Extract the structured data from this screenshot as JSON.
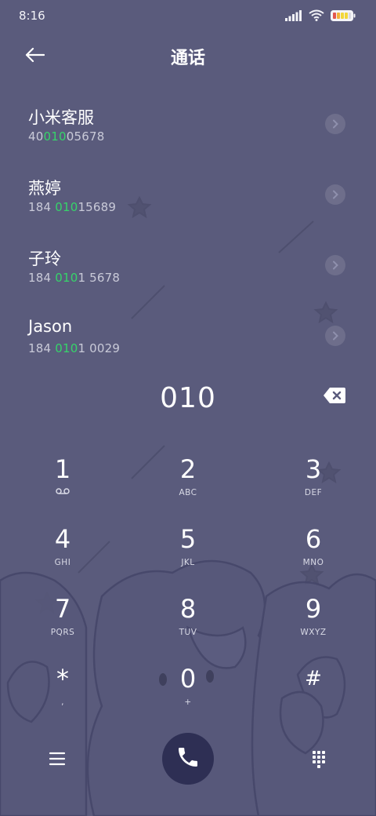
{
  "status_bar": {
    "time": "8:16",
    "icons": [
      "signal-icon",
      "wifi-icon",
      "battery-icon"
    ]
  },
  "header": {
    "title": "通话",
    "back_icon": "arrow-left-icon"
  },
  "contacts": [
    {
      "name": "小米客服",
      "number_pre": "40",
      "number_match": "010",
      "number_post": "05678"
    },
    {
      "name": "燕婷",
      "number_pre": "184 ",
      "number_match": "010",
      "number_post": "15689"
    },
    {
      "name": "子玲",
      "number_pre": "184 ",
      "number_match": "010",
      "number_post": "1 5678"
    },
    {
      "name": "Jason",
      "number_pre": "184 ",
      "number_match": "010",
      "number_post": "1 0029"
    }
  ],
  "dial": {
    "entered": "010",
    "backspace_icon": "backspace-icon"
  },
  "keypad": [
    {
      "digit": "1",
      "letters": "",
      "sub_icon": "voicemail-icon"
    },
    {
      "digit": "2",
      "letters": "ABC"
    },
    {
      "digit": "3",
      "letters": "DEF"
    },
    {
      "digit": "4",
      "letters": "GHI"
    },
    {
      "digit": "5",
      "letters": "JKL"
    },
    {
      "digit": "6",
      "letters": "MNO"
    },
    {
      "digit": "7",
      "letters": "PQRS"
    },
    {
      "digit": "8",
      "letters": "TUV"
    },
    {
      "digit": "9",
      "letters": "WXYZ"
    },
    {
      "digit": "*",
      "letters": ","
    },
    {
      "digit": "0",
      "letters": "+"
    },
    {
      "digit": "#",
      "letters": ""
    }
  ],
  "bottom_bar": {
    "menu_icon": "menu-icon",
    "call_icon": "phone-icon",
    "keypad_icon": "dialpad-icon"
  },
  "colors": {
    "background": "#5a5b7c",
    "match_highlight": "#36d46a",
    "call_button": "#2e2f54"
  }
}
